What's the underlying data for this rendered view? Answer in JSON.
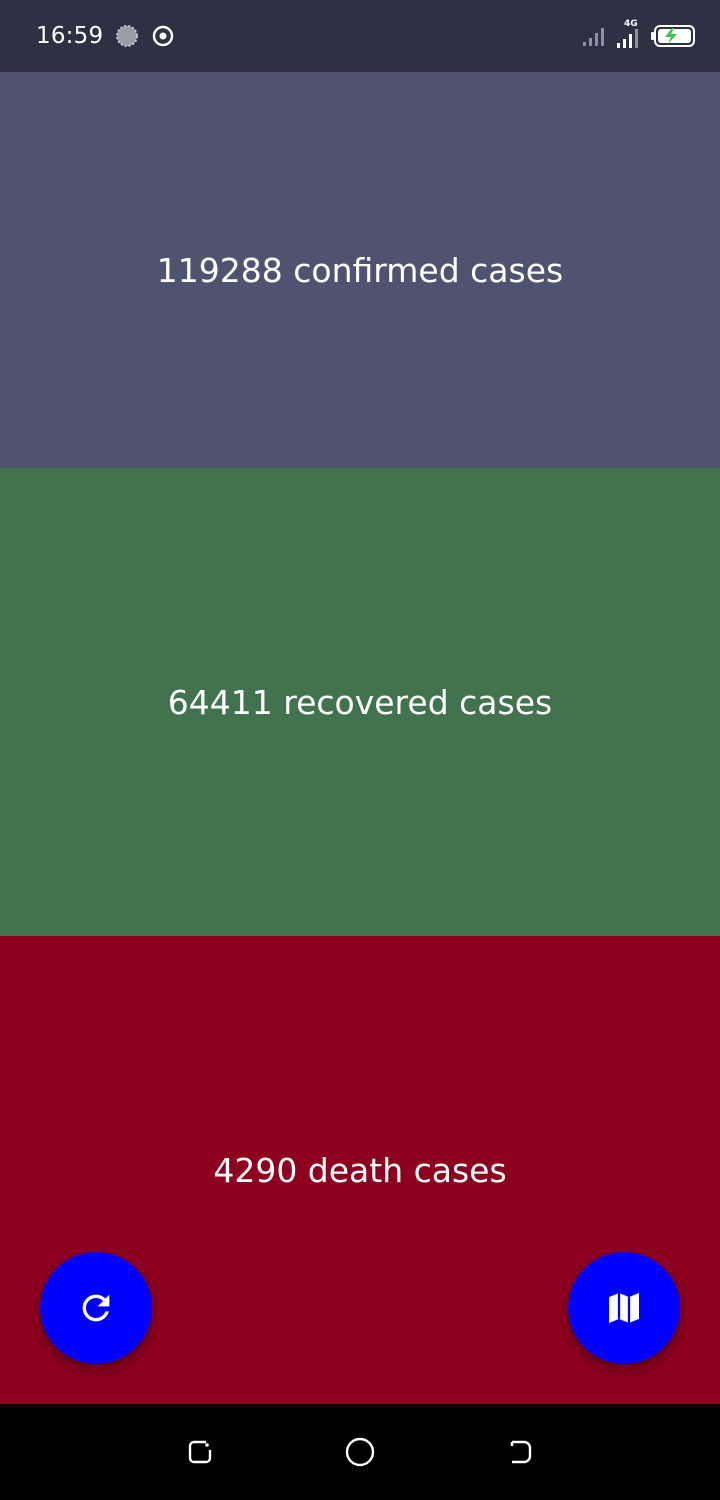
{
  "status_bar": {
    "time": "16:59",
    "network_label": "4G",
    "icons": [
      "loading-icon",
      "location-target-icon",
      "signal-icon",
      "signal-4g-icon",
      "battery-charging-icon"
    ]
  },
  "panels": {
    "confirmed": {
      "label": "119288 confirmed cases",
      "color": "#4e5470"
    },
    "recovered": {
      "label": "64411 recovered cases",
      "color": "#41734f"
    },
    "deaths": {
      "label": "4290 death cases",
      "color": "#8d011f"
    }
  },
  "fabs": {
    "refresh": {
      "icon": "refresh-icon",
      "color": "#0000fe"
    },
    "map": {
      "icon": "map-icon",
      "color": "#0000fe"
    }
  },
  "nav_bar": {
    "icons": [
      "recents-icon",
      "home-icon",
      "back-icon"
    ]
  }
}
